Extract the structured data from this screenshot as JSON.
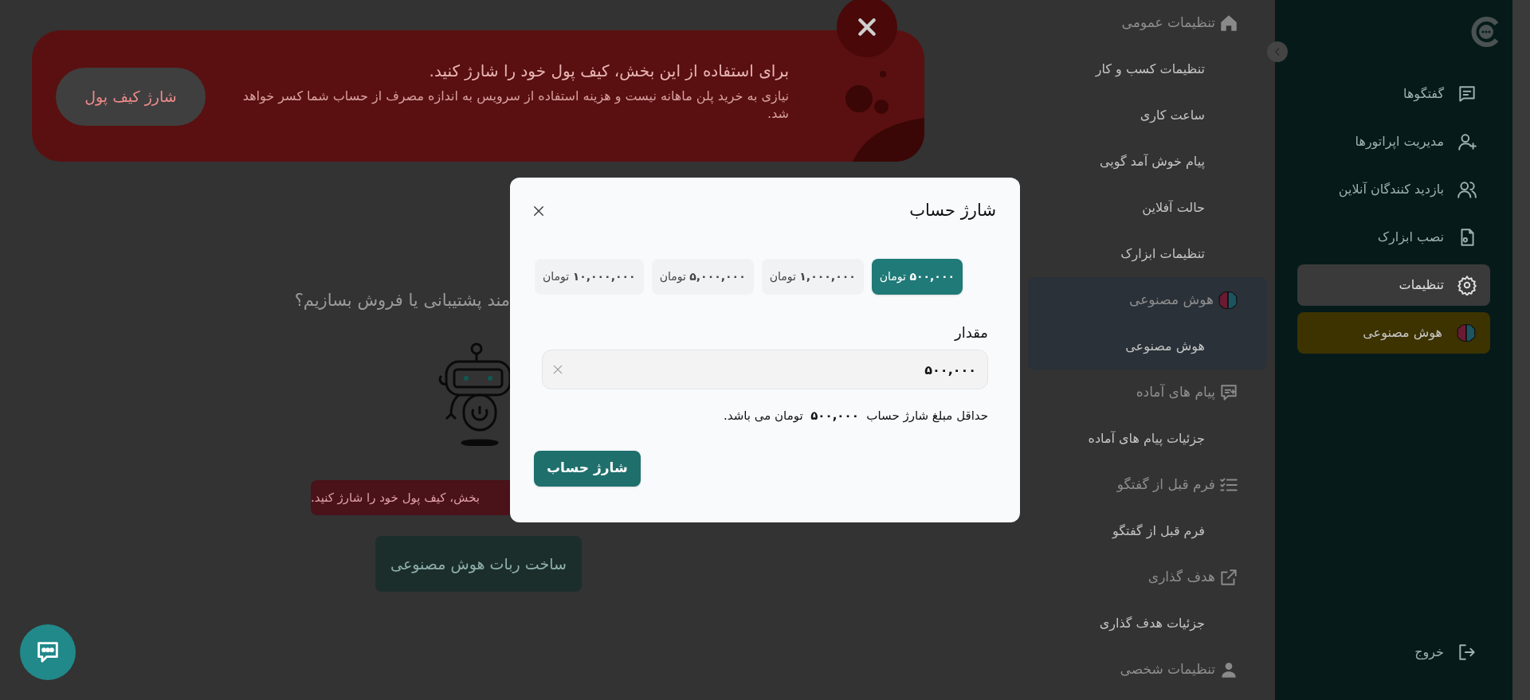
{
  "banner": {
    "title": "برای استفاده از این بخش، کیف پول خود را شارژ کنید.",
    "text": "نیازی به خرید پلن ماهانه نیست و هزینه استفاده از سرویس به اندازه مصرف از حساب شما کسر خواهد شد.",
    "button": "شارژ کیف پول"
  },
  "main": {
    "heading": "مند پشتیبانی یا فروش بسازیم؟",
    "alert": "بخش، کیف پول خود را شارژ کنید.",
    "button": "ساخت ربات هوش مصنوعی"
  },
  "settings_menu": [
    {
      "title": "تنظیمات عمومی",
      "selected": false,
      "items": [
        "تنظیمات کسب و کار",
        "ساعت کاری",
        "پیام خوش آمد گویی",
        "حالت آفلاین",
        "تنظیمات ابزارک"
      ]
    },
    {
      "title": "هوش مصنوعی",
      "selected": true,
      "items": [
        "هوش مصنوعی"
      ]
    },
    {
      "title": "پیام های آماده",
      "selected": false,
      "items": [
        "جزئیات پیام های آماده"
      ]
    },
    {
      "title": "فرم قبل از گفتگو",
      "selected": false,
      "items": [
        "فرم قبل از گفتگو"
      ]
    },
    {
      "title": "هدف گذاری",
      "selected": false,
      "items": [
        "جزئیات هدف گذاری"
      ]
    },
    {
      "title": "تنظیمات شخصی",
      "selected": false
    }
  ],
  "sidebar": {
    "items": [
      {
        "label": "گفتگوها",
        "selected": false,
        "highlighted": false
      },
      {
        "label": "مدیریت اپراتورها",
        "selected": false,
        "highlighted": false
      },
      {
        "label": "بازدید کنندگان آنلاین",
        "selected": false,
        "highlighted": false
      },
      {
        "label": "نصب ابزارک",
        "selected": false,
        "highlighted": false
      },
      {
        "label": "تنظیمات",
        "selected": true,
        "highlighted": false
      },
      {
        "label": "هوش مصنوعی",
        "selected": false,
        "highlighted": true
      }
    ],
    "logout": "خروج"
  },
  "modal": {
    "title": "شارژ حساب",
    "presets": [
      {
        "label": "**۵۰۰,۰۰۰** تومان",
        "selected": true
      },
      {
        "label": "**۱,۰۰۰,۰۰۰** تومان",
        "selected": false
      },
      {
        "label": "**۵,۰۰۰,۰۰۰** تومان",
        "selected": false
      },
      {
        "label": "**۱۰,۰۰۰,۰۰۰** تومان",
        "selected": false
      }
    ],
    "amount_label": "مقدار",
    "amount_value": "۵۰۰,۰۰۰",
    "note": "حداقل مبلغ شارژ حساب  **۵۰۰,۰۰۰**  تومان می باشد.",
    "submit": "شارژ حساب"
  }
}
